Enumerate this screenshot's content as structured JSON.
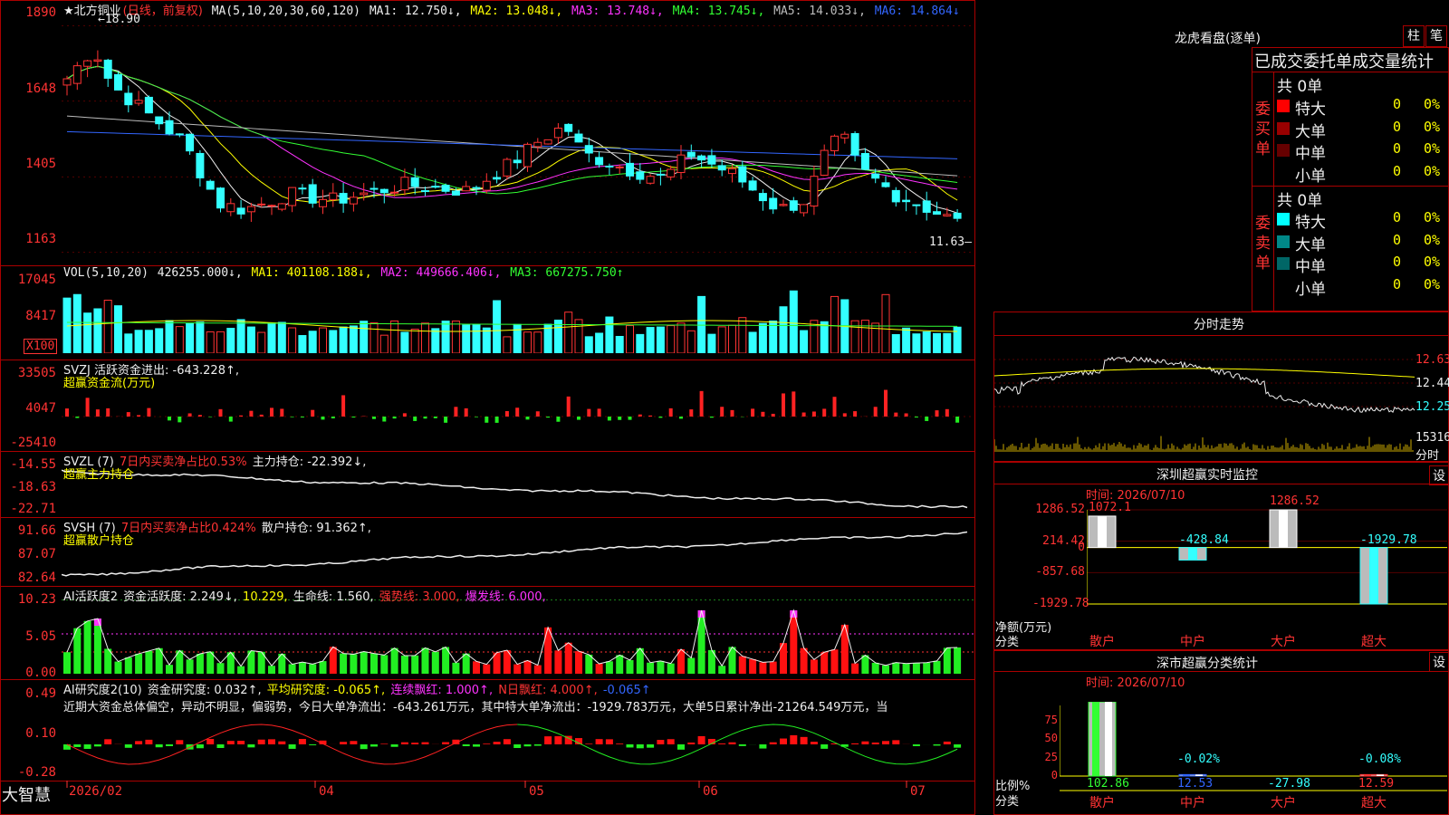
{
  "main": {
    "title": "★北方铜业",
    "period": "(日线，前复权)",
    "ma_label": "MA(5,10,20,30,60,120)",
    "ma_values": [
      {
        "label": "MA1: 12.750↓,",
        "color": "#eeeeee"
      },
      {
        "label": "MA2: 13.048↓,",
        "color": "#ffff00"
      },
      {
        "label": "MA3: 13.748↓,",
        "color": "#ff33ff"
      },
      {
        "label": "MA4: 13.745↓,",
        "color": "#33ff33"
      },
      {
        "label": "MA5: 14.033↓,",
        "color": "#bbbbbb"
      },
      {
        "label": "MA6: 14.864↓",
        "color": "#3366ff"
      }
    ],
    "y_ticks": [
      "1890",
      "1648",
      "1405",
      "1163"
    ],
    "high_label": "18.90",
    "low_label": "11.63"
  },
  "vol": {
    "label": "VOL(5,10,20)",
    "value": "426255.000↓,",
    "ma1": "MA1: 401108.188↓,",
    "ma2": "MA2: 449666.406↓,",
    "ma3": "MA3: 667275.750↑",
    "y_ticks": [
      "17045",
      "8417"
    ],
    "unit": "X100"
  },
  "svzj": {
    "label": "SVZJ  活跃资金进出: -643.228↑,",
    "sub": "超赢资金流(万元)",
    "y_ticks": [
      "33505",
      "4047",
      "-25410"
    ]
  },
  "svzl": {
    "label": "SVZL (7)",
    "ratio": "7日内买卖净占比0.53%",
    "hold": "主力持仓: -22.392↓,",
    "sub": "超赢主力持仓",
    "y_ticks": [
      "-14.55",
      "-18.63",
      "-22.71"
    ]
  },
  "svsh": {
    "label": "SVSH (7)",
    "ratio": "7日内买卖净占比0.424%",
    "hold": "散户持仓: 91.362↑,",
    "sub": "超赢散户持仓",
    "y_ticks": [
      "91.66",
      "87.07",
      "82.64"
    ]
  },
  "ai2": {
    "label": "AI活跃度2",
    "a": "资金活跃度: 2.249↓,",
    "b": "10.229,",
    "c": "生命线: 1.560,",
    "d": "强势线: 3.000,",
    "e": "爆发线: 6.000,",
    "y_ticks": [
      "10.23",
      "5.05",
      "0.00"
    ]
  },
  "ai_res": {
    "label": "AI研究度2(10)",
    "a": "资金研究度: 0.032↑,",
    "b": "平均研究度: -0.065↑,",
    "c": "连续飘红: 1.000↑,",
    "d": "N日飘红: 4.000↑,",
    "e": "-0.065↑",
    "desc": "近期大资金总体偏空，异动不明显，偏弱势，今日大单净流出：-643.261万元，其中特大单净流出：-1929.783万元，大单5日累计净出-21264.549万元，当",
    "y_ticks": [
      "0.49",
      "0.10",
      "-0.28"
    ]
  },
  "xaxis": {
    "brand": "大智慧",
    "labels": [
      "2026/02",
      "04",
      "05",
      "06",
      "07"
    ]
  },
  "right": {
    "lhb_title": "龙虎看盘(逐单)",
    "tab_zhu": "柱",
    "tab_bi": "笔",
    "stat_title": "已成交委托单成交量统计",
    "buy": {
      "side_label": "委买单",
      "total": "共 0单",
      "rows": [
        {
          "name": "特大",
          "val": "0",
          "pct": "0%",
          "color": "#ff0000"
        },
        {
          "name": "大单",
          "val": "0",
          "pct": "0%",
          "color": "#990000"
        },
        {
          "name": "中单",
          "val": "0",
          "pct": "0%",
          "color": "#660000"
        },
        {
          "name": "小单",
          "val": "0",
          "pct": "0%",
          "color": ""
        }
      ]
    },
    "sell": {
      "side_label": "委卖单",
      "total": "共 0单",
      "rows": [
        {
          "name": "特大",
          "val": "0",
          "pct": "0%",
          "color": "#00ffff"
        },
        {
          "name": "大单",
          "val": "0",
          "pct": "0%",
          "color": "#008888"
        },
        {
          "name": "中单",
          "val": "0",
          "pct": "0%",
          "color": "#006666"
        },
        {
          "name": "小单",
          "val": "0",
          "pct": "0%",
          "color": ""
        }
      ]
    },
    "fenshi": {
      "title": "分时走势",
      "y_ticks": [
        "12.63",
        "12.44",
        "12.25"
      ],
      "vol_label": "15316",
      "vol_label2": "分时"
    },
    "monitor": {
      "title": "深圳超赢实时监控",
      "settings": "设",
      "time": "时间: 2026/07/10",
      "y_ticks": [
        "1286.52",
        "214.42",
        "0",
        "-857.68",
        "-1929.78"
      ],
      "unit": "净额(万元)",
      "cat_label": "分类",
      "categories": [
        "散户",
        "中户",
        "大户",
        "超大"
      ],
      "values": [
        1072.1,
        -428.84,
        1286.52,
        -1929.78
      ],
      "value_labels": [
        "1072.1",
        "-428.84",
        "1286.52",
        "-1929.78"
      ]
    },
    "class_stat": {
      "title": "深市超赢分类统计",
      "settings": "设",
      "time": "时间: 2026/07/10",
      "y_ticks": [
        "75",
        "50",
        "25",
        "0"
      ],
      "unit": "比例%",
      "cat_label": "分类",
      "categories": [
        "散户",
        "中户",
        "大户",
        "超大"
      ],
      "top_labels": [
        "",
        "-0.02%",
        "",
        "-0.08%"
      ],
      "bottom_labels": [
        "102.86",
        "12.53",
        "-27.98",
        "12.59"
      ]
    }
  }
}
